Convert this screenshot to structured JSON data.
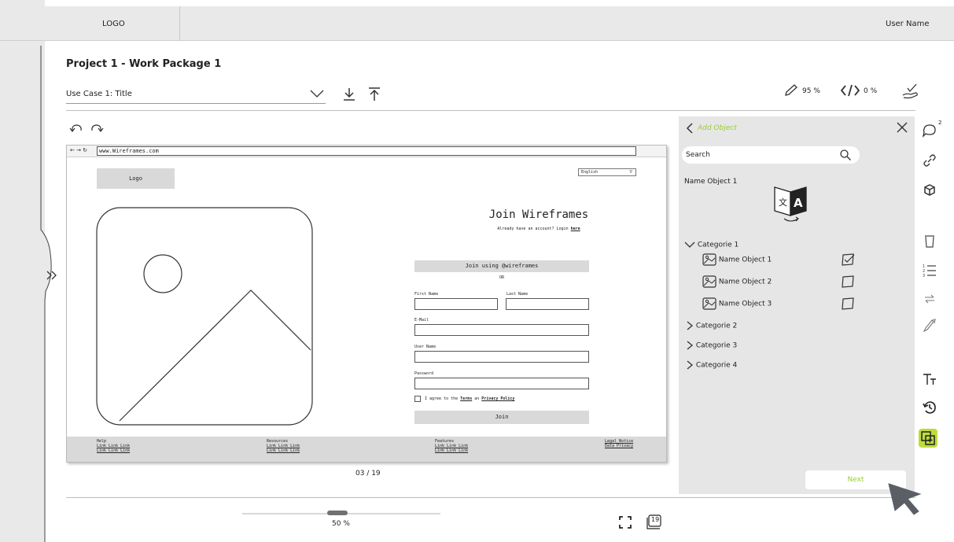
{
  "header": {
    "logo": "LOGO",
    "user_name": "User Name"
  },
  "project": {
    "title": "Project 1 - Work Package 1",
    "use_case": "Use Case 1: Title"
  },
  "stats": {
    "edit_percent": "95 %",
    "code_percent": "0 %"
  },
  "mockup": {
    "url": "www.Wireframes.com",
    "logo": "Logo",
    "language": "English",
    "join_title": "Join Wireframes",
    "join_subtitle_prefix": "Already have an account? Login",
    "join_subtitle_link": "here",
    "join_using": "Join using @wireframes",
    "or": "OR",
    "first_name": "First Name",
    "last_name": "Last Name",
    "email": "E-Mail",
    "user_name": "User Name",
    "password": "Password",
    "agree_prefix": "I agree to the",
    "terms": "Terms",
    "agree_mid": "an",
    "privacy": "Privacy Policy",
    "join_button": "Join",
    "footer": {
      "col1_title": "Help",
      "col2_title": "Resources",
      "col3_title": "Features",
      "col4_line1": "Legal Notice",
      "col4_line2": "Data Privacy",
      "links": "Link Link Link"
    }
  },
  "pagination": {
    "current": "03 / 19",
    "pages_badge": "19"
  },
  "panel": {
    "title": "Add Object",
    "search_label": "Search",
    "name_object_heading": "Name Object 1",
    "categories": [
      {
        "label": "Categorie 1",
        "expanded": true,
        "objects": [
          {
            "label": "Name Object 1",
            "checked": true
          },
          {
            "label": "Name Object 2",
            "checked": false
          },
          {
            "label": "Name Object 3",
            "checked": false
          }
        ]
      },
      {
        "label": "Categorie 2",
        "expanded": false
      },
      {
        "label": "Categorie 3",
        "expanded": false
      },
      {
        "label": "Categorie 4",
        "expanded": false
      }
    ],
    "next_label": "Next"
  },
  "toolbar": {
    "comment_count": "2"
  },
  "zoom": {
    "label": "50 %",
    "value_percent": 50
  },
  "colors": {
    "accent": "#9acd32",
    "active_tool": "#bedc3c",
    "panel_bg": "#e6e6e6",
    "chrome_bg": "#e9e9e9"
  },
  "icons": {
    "expand_panel": "double-chevron-right-icon",
    "download": "download-icon",
    "upload": "upload-icon",
    "edit": "pencil-icon",
    "code": "code-icon",
    "approve": "hand-check-icon",
    "undo": "undo-icon",
    "redo": "redo-icon",
    "close": "close-icon",
    "search": "search-icon",
    "translate": "translate-icon",
    "comment": "comment-icon",
    "link": "link-icon",
    "cube": "cube-icon",
    "trash": "trash-icon",
    "list": "numbered-list-icon",
    "swap": "swap-icon",
    "paint": "paint-brush-icon",
    "text": "text-size-icon",
    "history": "history-icon",
    "layers": "layers-icon",
    "fullscreen": "fullscreen-icon",
    "pages": "pages-icon",
    "cursor": "cursor-icon"
  }
}
